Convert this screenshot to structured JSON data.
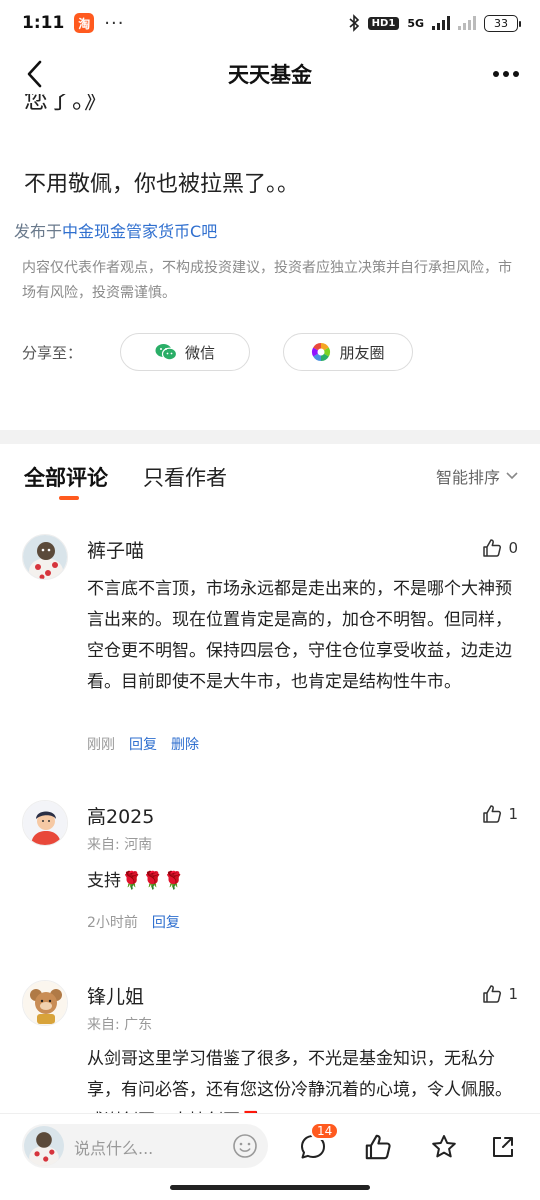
{
  "status_bar": {
    "time": "1:11",
    "app_badge": "淘",
    "dots": "···",
    "hd": "HD1",
    "network": "5G",
    "battery": "33"
  },
  "header": {
    "title": "天天基金"
  },
  "post": {
    "clipped_line": "您了。》",
    "body": "不用敬佩，你也被拉黑了。。",
    "published_prefix": "发布于",
    "published_forum": "中金现金管家货币C吧",
    "disclaimer": "内容仅代表作者观点，不构成投资建议，投资者应独立决策并自行承担风险，市场有风险，投资需谨慎。",
    "share_label": "分享至：",
    "share_wechat": "微信",
    "share_moments": "朋友圈"
  },
  "tabs": {
    "all": "全部评论",
    "author_only": "只看作者",
    "sort": "智能排序"
  },
  "comments": [
    {
      "name": "裤子喵",
      "likes": "0",
      "body": "不言底不言顶，市场永远都是走出来的，不是哪个大神预言出来的。现在位置肯定是高的，加仓不明智。但同样，空仓更不明智。保持四层仓，守住仓位享受收益，边走边看。目前即使不是大牛市，也肯定是结构性牛市。",
      "time": "刚刚",
      "reply": "回复",
      "delete": "删除"
    },
    {
      "name": "高2025",
      "likes": "1",
      "region": "来自: 河南",
      "body": "支持🌹🌹🌹",
      "time": "2小时前",
      "reply": "回复"
    },
    {
      "name": "锋儿姐",
      "likes": "1",
      "region": "来自: 广东",
      "body": "从剑哥这里学习借鉴了很多，不光是基金知识，无私分享，有问必答，还有您这份冷静沉着的心境，令人佩服。感谢剑哥，支持剑哥🧧"
    }
  ],
  "bottom_bar": {
    "placeholder": "说点什么...",
    "comment_count": "14"
  }
}
